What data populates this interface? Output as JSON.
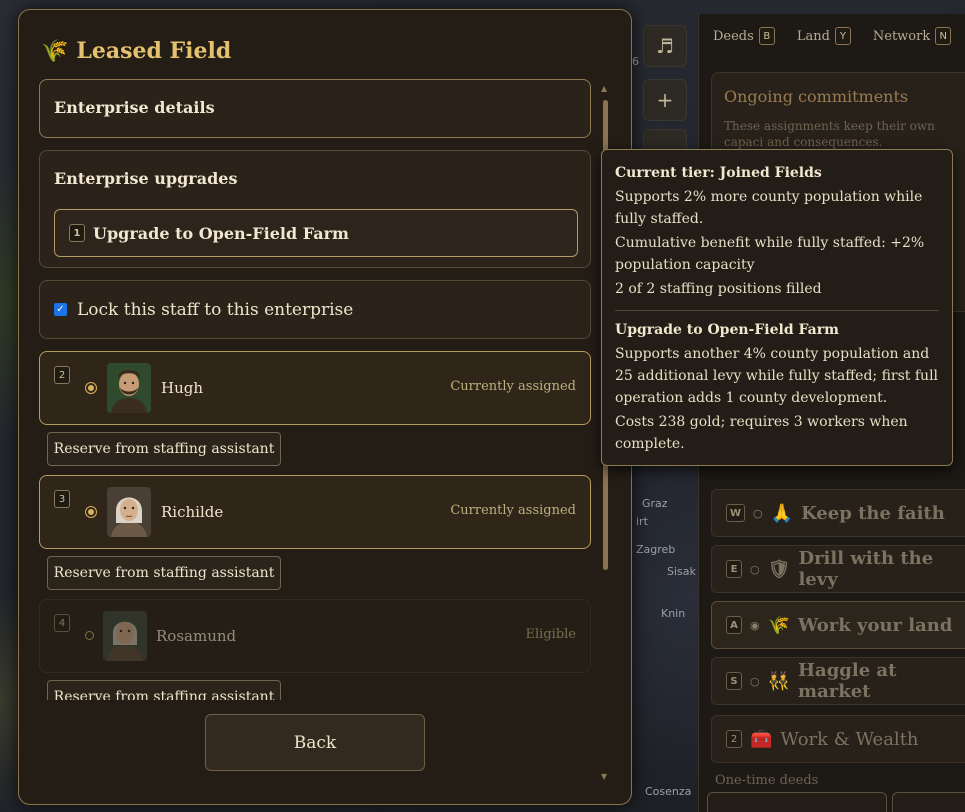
{
  "dialog": {
    "title": "Leased Field",
    "title_icon": "wheat-icon",
    "sections": {
      "details_title": "Enterprise details",
      "upgrades_title": "Enterprise upgrades",
      "upgrade_button": {
        "key": "1",
        "label": "Upgrade to Open-Field Farm"
      },
      "lock_label": "Lock this staff to this enterprise",
      "lock_checked": true
    },
    "staff": [
      {
        "key": "2",
        "name": "Hugh",
        "status": "Currently assigned",
        "selected": true,
        "reserve_label": "Reserve from staffing assistant"
      },
      {
        "key": "3",
        "name": "Richilde",
        "status": "Currently assigned",
        "selected": true,
        "reserve_label": "Reserve from staffing assistant"
      },
      {
        "key": "4",
        "name": "Rosamund",
        "status": "Eligible",
        "selected": false,
        "reserve_label": "Reserve from staffing assistant"
      }
    ],
    "back_label": "Back"
  },
  "side_buttons": [
    {
      "icon": "music-icon",
      "glyph": "♬"
    },
    {
      "icon": "plus-icon",
      "glyph": "+"
    },
    {
      "icon": "minus-icon",
      "glyph": ""
    }
  ],
  "map_labels": [
    "Graz",
    "Zagreb",
    "Sisak",
    "Knin",
    "Cosenza",
    "irt",
    "6"
  ],
  "right_panel": {
    "tabs": [
      {
        "label": "Deeds",
        "key": "B"
      },
      {
        "label": "Land",
        "key": "Y"
      },
      {
        "label": "Network",
        "key": "N"
      }
    ],
    "commitments": {
      "title": "Ongoing commitments",
      "description": "These assignments keep their own capaci and consequences."
    },
    "actions": [
      {
        "key": "W",
        "marker": "○",
        "icon": "🙏",
        "label": "Keep the faith"
      },
      {
        "key": "E",
        "marker": "○",
        "icon": "🛡",
        "label": "Drill with the levy"
      },
      {
        "key": "A",
        "marker": "◉",
        "icon": "🌾",
        "label": "Work your land"
      },
      {
        "key": "S",
        "marker": "○",
        "icon": "👯",
        "label": "Haggle at market"
      },
      {
        "key": "2",
        "marker": "",
        "icon": "🧰",
        "label": "Work & Wealth"
      }
    ],
    "one_time_label": "One-time deeds"
  },
  "tooltip": {
    "current_title": "Current tier: Joined Fields",
    "current_lines": [
      "Supports 2% more county population while fully staffed.",
      "Cumulative benefit while fully staffed: +2% population capacity",
      "2 of 2 staffing positions filled"
    ],
    "upgrade_title": "Upgrade to Open-Field Farm",
    "upgrade_lines": [
      "Supports another 4% county population and 25 additional levy while fully staffed; first full operation adds 1 county development.",
      "Costs 238 gold; requires 3 workers when complete."
    ]
  },
  "colors": {
    "accent_gold": "#e4c16e",
    "panel_bg": "#231d15",
    "checkbox_blue": "#1a73e8",
    "status_text": "#b9b27e"
  }
}
